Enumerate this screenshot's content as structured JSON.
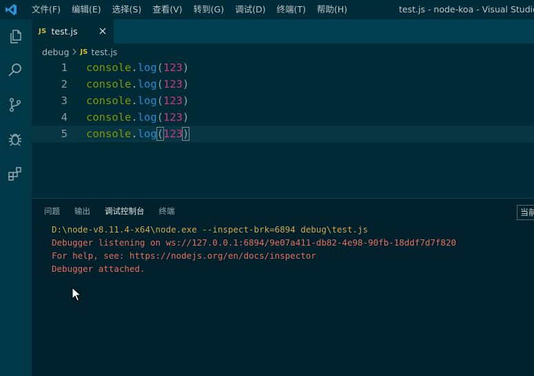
{
  "titlebar": {
    "menu": [
      "文件(F)",
      "编辑(E)",
      "选择(S)",
      "查看(V)",
      "转到(G)",
      "调试(D)",
      "终端(T)",
      "帮助(H)"
    ],
    "window_title": "test.js - node-koa - Visual Studio Code"
  },
  "tab": {
    "badge": "JS",
    "label": "test.js"
  },
  "breadcrumb": {
    "folder": "debug",
    "badge": "JS",
    "file": "test.js"
  },
  "editor": {
    "lines": [
      {
        "num": "1",
        "obj": "console",
        "dot": ".",
        "fn": "log",
        "open": "(",
        "arg": "123",
        "close": ")"
      },
      {
        "num": "2",
        "obj": "console",
        "dot": ".",
        "fn": "log",
        "open": "(",
        "arg": "123",
        "close": ")"
      },
      {
        "num": "3",
        "obj": "console",
        "dot": ".",
        "fn": "log",
        "open": "(",
        "arg": "123",
        "close": ")"
      },
      {
        "num": "4",
        "obj": "console",
        "dot": ".",
        "fn": "log",
        "open": "(",
        "arg": "123",
        "close": ")"
      },
      {
        "num": "5",
        "obj": "console",
        "dot": ".",
        "fn": "log",
        "open": "(",
        "arg": "123",
        "close": ")"
      }
    ]
  },
  "panel": {
    "tabs": [
      "问题",
      "输出",
      "调试控制台",
      "终端"
    ],
    "right_label": "当前",
    "console": [
      "D:\\node-v8.11.4-x64\\node.exe --inspect-brk=6894 debug\\test.js",
      "Debugger listening on ws://127.0.0.1:6894/9e07a411-db82-4e98-90fb-18ddf7d7f820",
      "For help, see: https://nodejs.org/en/docs/inspector",
      "Debugger attached."
    ]
  },
  "colors": {
    "background": "#002b36",
    "keyword": "#859900",
    "function": "#268bd2",
    "number": "#d33682",
    "console_error": "#e76d5c",
    "console_command": "#d4a64e"
  },
  "icons": {
    "logo": "vscode-logo-icon",
    "explorer": "files-icon",
    "search": "search-icon",
    "scm": "source-control-icon",
    "debug": "bug-icon",
    "extensions": "extensions-icon",
    "close": "close-icon",
    "chevron": "chevron-right-icon",
    "pointer": "mouse-pointer-icon"
  }
}
